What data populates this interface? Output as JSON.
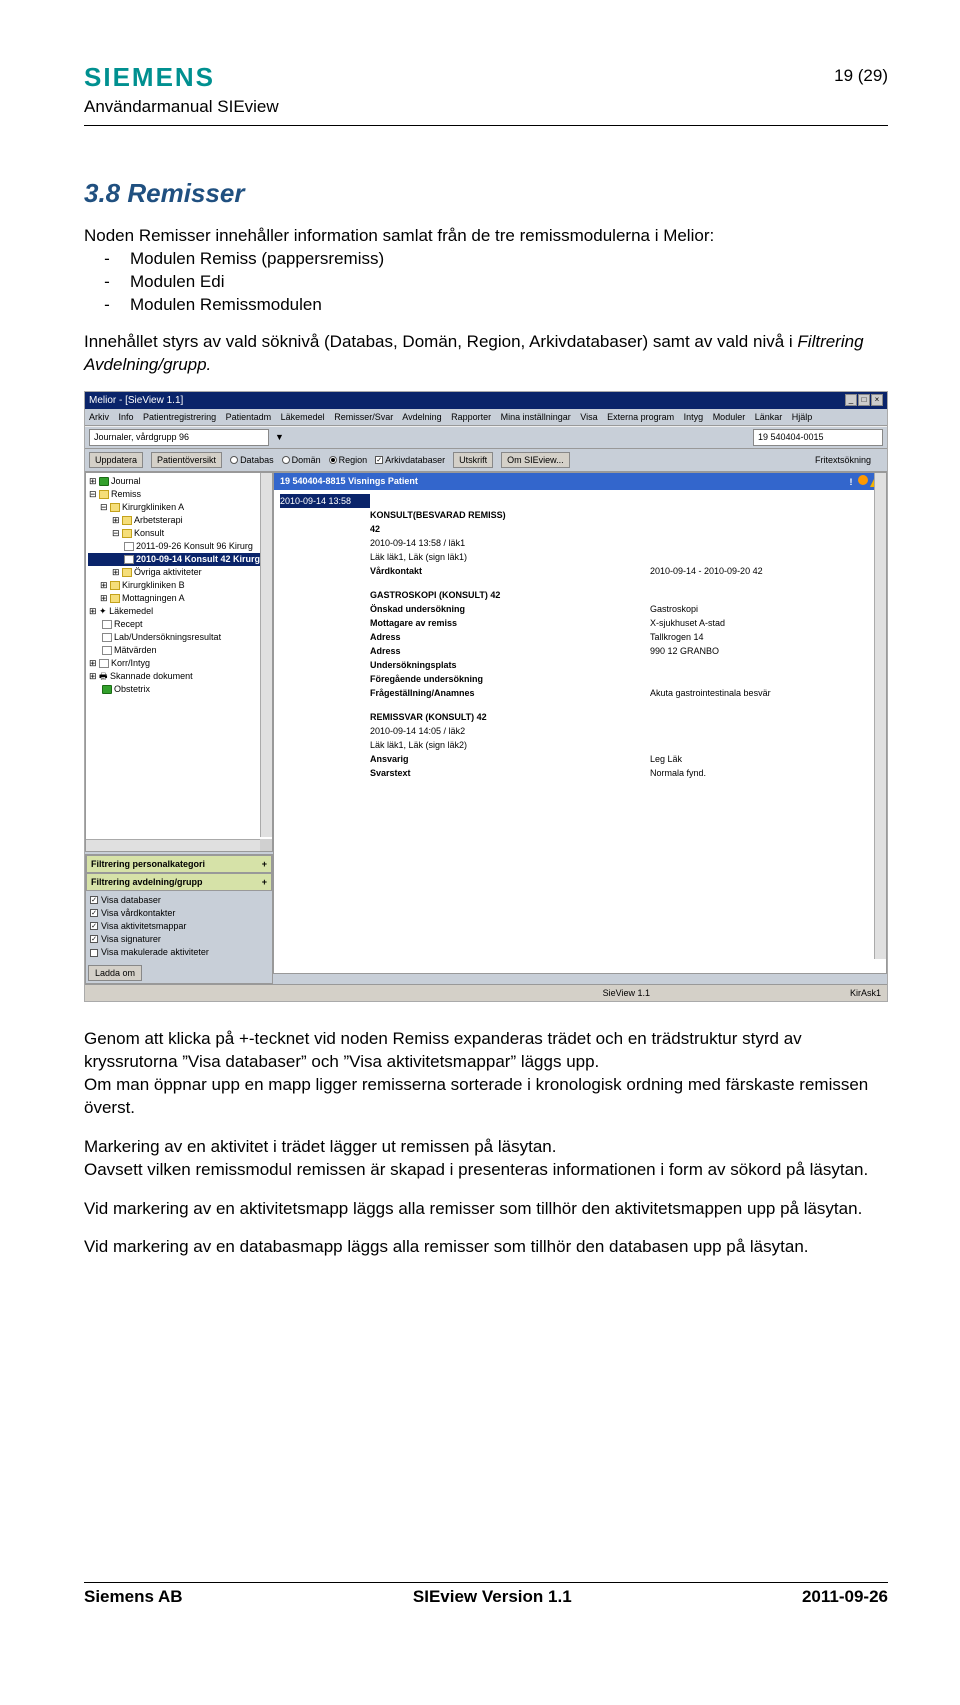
{
  "header": {
    "logo": "SIEMENS",
    "subtitle": "Användarmanual SIEview",
    "page_num": "19 (29)"
  },
  "section": {
    "title": "3.8  Remisser"
  },
  "p_intro": "Noden Remisser innehåller information samlat från de tre remissmodulerna i Melior:",
  "modules": [
    "Modulen Remiss (pappersremiss)",
    "Modulen Edi",
    "Modulen Remissmodulen"
  ],
  "p_filter_a": "Innehållet styrs av vald söknivå (Databas, Domän, Region, Arkivdatabaser) samt av vald nivå i ",
  "p_filter_i": "Filtrering Avdelning/grupp.",
  "after1": "Genom att klicka på +-tecknet vid noden Remiss expanderas trädet och en trädstruktur styrd av kryssrutorna ”Visa databaser” och ”Visa aktivitetsmappar” läggs upp.",
  "after2": "Om man öppnar upp en mapp ligger remisserna sorterade i kronologisk ordning med färskaste remissen överst.",
  "after3": "Markering av en aktivitet i trädet lägger ut remissen på läsytan.",
  "after4": "Oavsett vilken remissmodul remissen är skapad i presenteras informationen i form av sökord på läsytan.",
  "after5": "Vid markering av en aktivitetsmapp läggs alla remisser som tillhör den aktivitetsmappen upp på läsytan.",
  "after6": "Vid markering av en databasmapp läggs alla remisser som tillhör den databasen upp på läsytan.",
  "screenshot": {
    "title": "Melior - [SieView 1.1]",
    "menu": [
      "Arkiv",
      "Info",
      "Patientregistrering",
      "Patientadm",
      "Läkemedel",
      "Remisser/Svar",
      "Avdelning",
      "Rapporter",
      "Mina inställningar",
      "Visa",
      "Externa program",
      "Intyg",
      "Moduler",
      "Länkar",
      "Hjälp"
    ],
    "tb1": {
      "label1": "Journaler, vårdgrupp 96",
      "patient_id": "19 540404-0015"
    },
    "tb2": {
      "btn_update": "Uppdatera",
      "btn_po": "Patientöversikt",
      "r_db": "Databas",
      "r_dom": "Domän",
      "r_reg": "Region",
      "chk_ark": "Arkivdatabaser",
      "btn_print": "Utskrift",
      "btn_about": "Om SIEview...",
      "search": "Fritextsökning"
    },
    "tree": {
      "journal": "Journal",
      "remiss": "Remiss",
      "klinA": "Kirurgkliniken A",
      "arbter": "Arbetsterapi",
      "konsult": "Konsult",
      "item1": "2011-09-26 Konsult 96 Kirurg",
      "item2": "2010-09-14 Konsult 42 Kirurg",
      "ovriga": "Övriga aktiviteter",
      "klinB": "Kirurgkliniken B",
      "mottA": "Mottagningen A",
      "lakemedel": "Läkemedel",
      "recept": "Recept",
      "lab": "Lab/Undersökningsresultat",
      "matvarden": "Mätvärden",
      "korr": "Korr/Intyg",
      "skannade": "Skannade dokument",
      "obst": "Obstetrix"
    },
    "filter1": "Filtrering personalkategori",
    "filter2": "Filtrering avdelning/grupp",
    "opts": {
      "db": "Visa databaser",
      "vk": "Visa vårdkontakter",
      "am": "Visa aktivitetsmappar",
      "sig": "Visa signaturer",
      "mak": "Visa makulerade aktiviteter"
    },
    "ladda": "Ladda om",
    "content_header": "19 540404-8815 Visnings Patient",
    "cp": {
      "date": "2010-09-14 13:58",
      "title1": "KONSULT(BESVARAD REMISS)",
      "title1_b": "42",
      "line1": "2010-09-14 13:58 / läk1",
      "line2": "Läk läk1, Läk (sign läk1)",
      "vk": "Vårdkontakt",
      "vk_v": "2010-09-14 - 2010-09-20 42",
      "vk_v2": "",
      "sec2": "GASTROSKOPI (KONSULT) 42",
      "r1l": "Önskad undersökning",
      "r1v": "Gastroskopi",
      "r2l": "Mottagare av remiss",
      "r2v": "X-sjukhuset A-stad",
      "r3l": "Adress",
      "r3v": "Tallkrogen 14",
      "r4l": "Adress",
      "r4v": "990 12 GRANBO",
      "r5l": "Undersökningsplats",
      "r5v": "",
      "r6l": "Föregående undersökning",
      "r6v": "",
      "r7l": "Frågeställning/Anamnes",
      "r7v": "Akuta gastrointestinala besvär",
      "sec3": "REMISSVAR (KONSULT) 42",
      "line3": "2010-09-14 14:05 / läk2",
      "line4": "Läk läk1, Läk (sign läk2)",
      "r8l": "Ansvarig",
      "r8v": "Leg Läk",
      "r9l": "Svarstext",
      "r9v": "Normala fynd."
    },
    "status_l": "SieView 1.1",
    "status_r": "KirAsk1"
  },
  "footer": {
    "company": "Siemens AB",
    "version": "SIEview Version 1.1",
    "date": "2011-09-26"
  }
}
